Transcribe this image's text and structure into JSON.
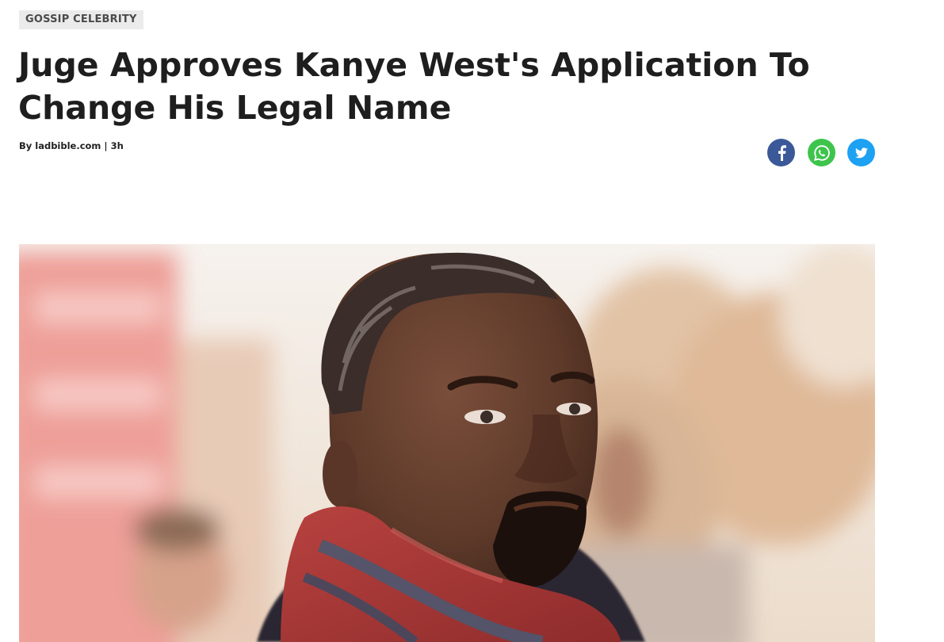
{
  "article": {
    "category": "GOSSIP CELEBRITY",
    "headline": "Juge Approves Kanye West's Application To Change His Legal Name",
    "byline": "By ladbible.com | 3h"
  },
  "share": [
    {
      "network": "facebook",
      "icon": "facebook-icon",
      "color": "#3b5998"
    },
    {
      "network": "whatsapp",
      "icon": "whatsapp-icon",
      "color": "#3ec44c"
    },
    {
      "network": "twitter",
      "icon": "twitter-icon",
      "color": "#1da1f2"
    }
  ],
  "hero_image": {
    "subject": "portrait photo of a man with a red scarf against a blurred outdoor background"
  }
}
